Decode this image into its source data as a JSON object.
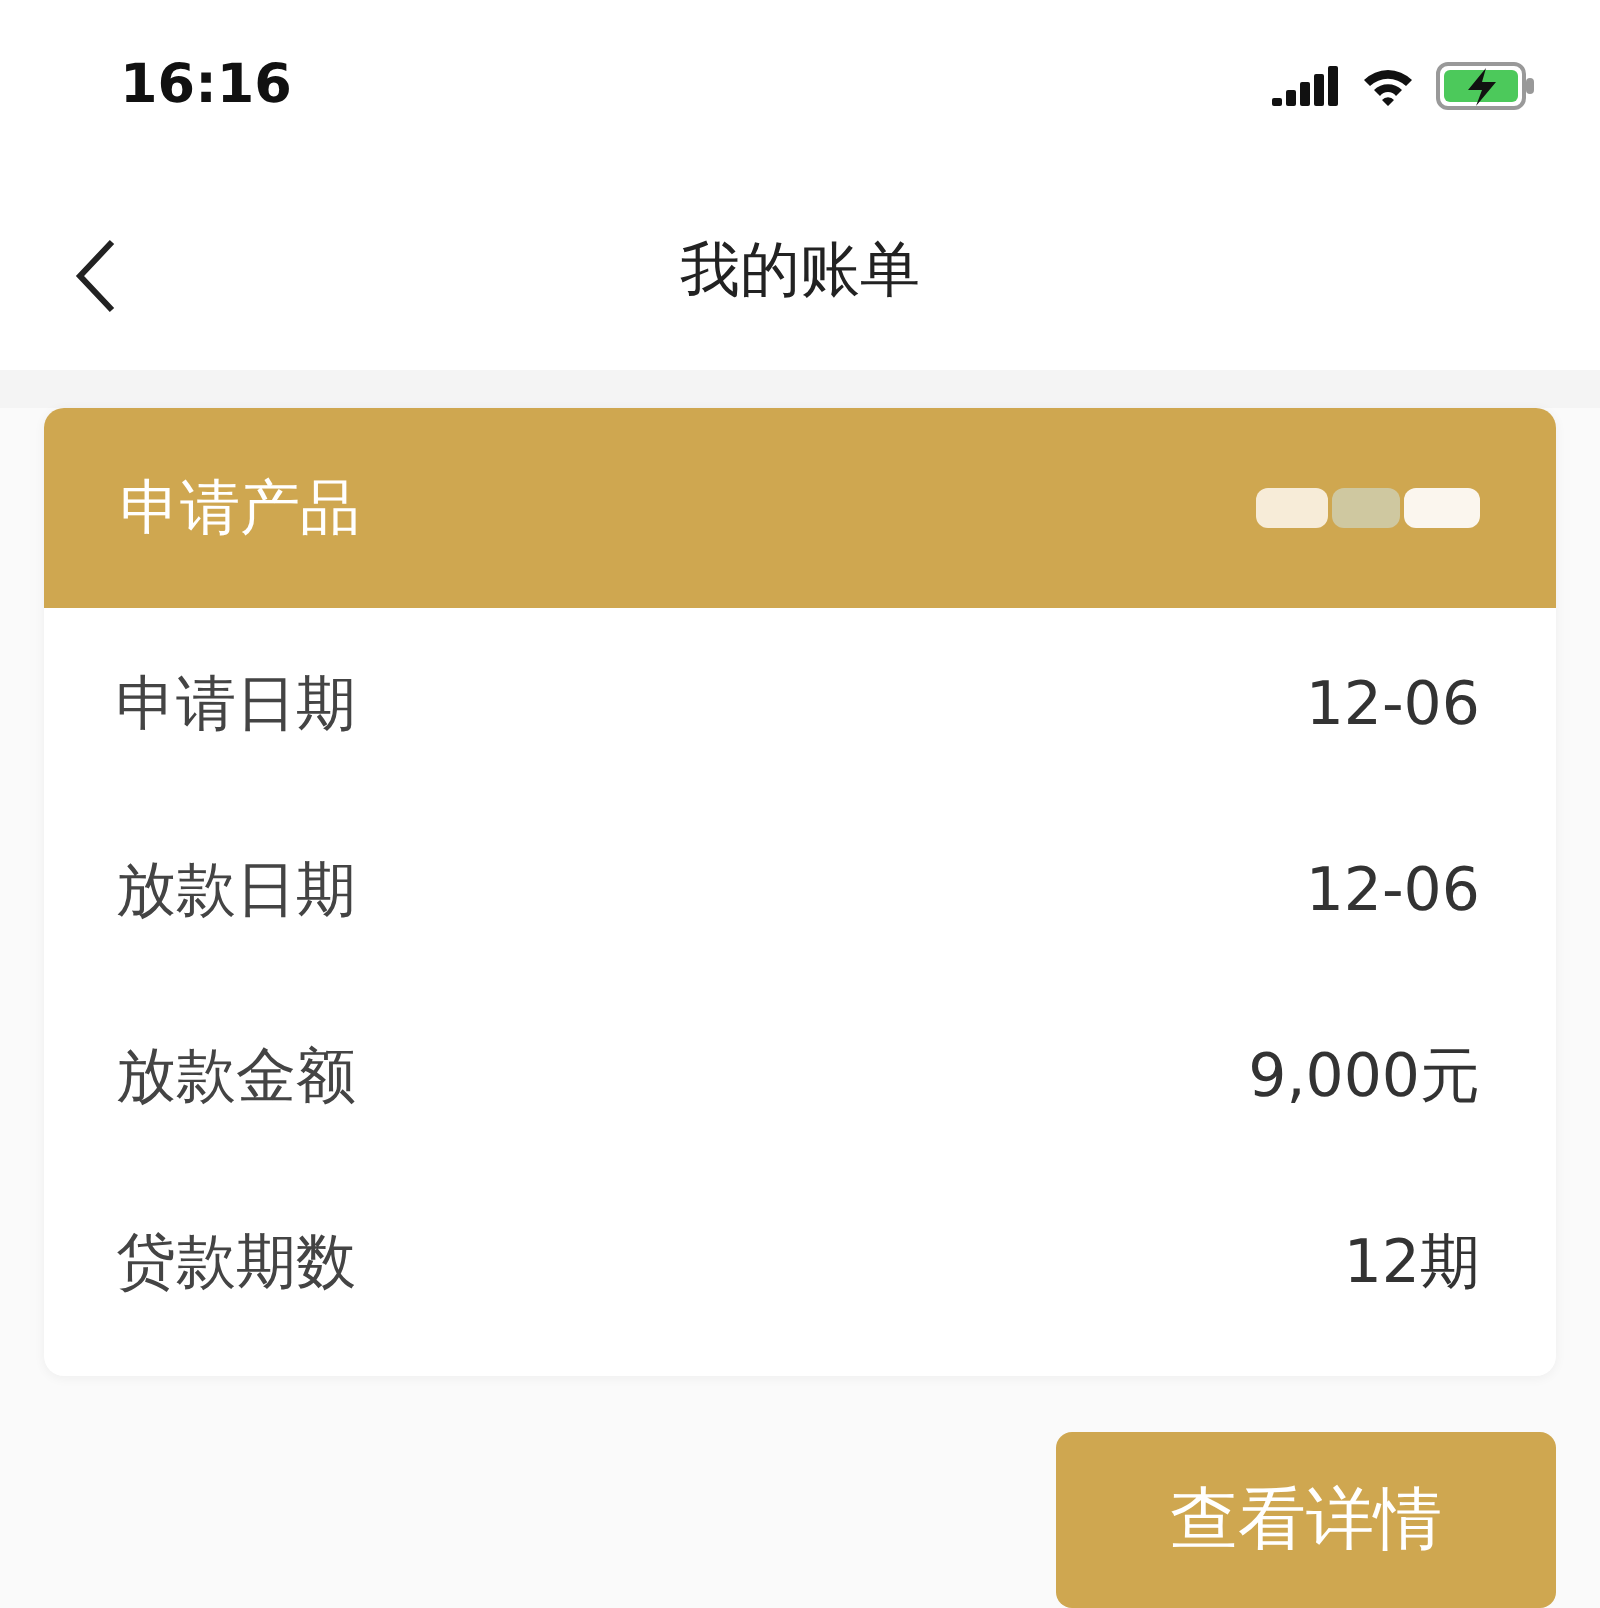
{
  "status_bar": {
    "time": "16:16"
  },
  "nav": {
    "title": "我的账单"
  },
  "card": {
    "header_label": "申请产品",
    "rows": [
      {
        "label": "申请日期",
        "value": "12-06"
      },
      {
        "label": "放款日期",
        "value": "12-06"
      },
      {
        "label": "放款金额",
        "value": "9,000元"
      },
      {
        "label": "贷款期数",
        "value": "12期"
      }
    ]
  },
  "button": "查看详情"
}
